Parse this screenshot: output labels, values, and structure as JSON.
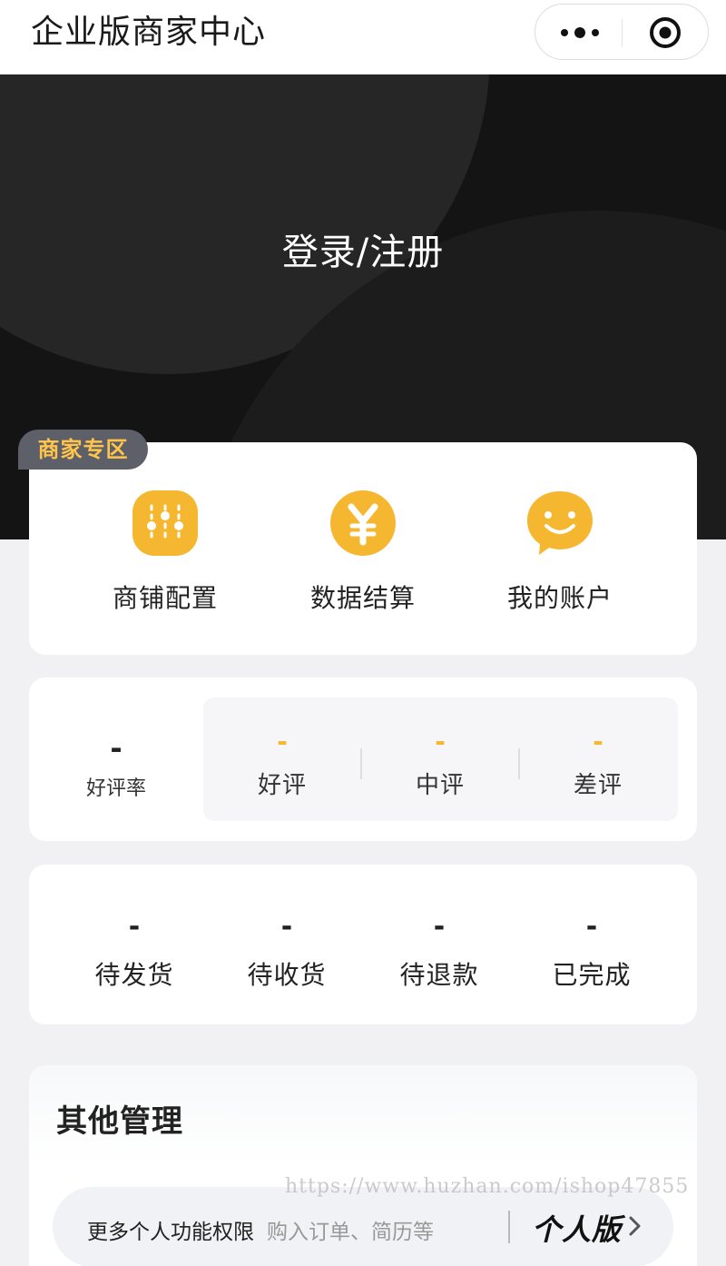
{
  "app": {
    "title": "企业版商家中心"
  },
  "capsule": {
    "more_icon": "more-dots-icon",
    "close_icon": "target-close-icon"
  },
  "hero": {
    "login_label": "登录/注册"
  },
  "merchant": {
    "badge": "商家专区",
    "items": [
      {
        "label": "商铺配置",
        "icon": "sliders-icon"
      },
      {
        "label": "数据结算",
        "icon": "yen-icon"
      },
      {
        "label": "我的账户",
        "icon": "smile-chat-icon"
      }
    ]
  },
  "reviews": {
    "rate": {
      "value": "-",
      "label": "好评率"
    },
    "items": [
      {
        "value": "-",
        "label": "好评"
      },
      {
        "value": "-",
        "label": "中评"
      },
      {
        "value": "-",
        "label": "差评"
      }
    ]
  },
  "orders": [
    {
      "value": "-",
      "label": "待发货"
    },
    {
      "value": "-",
      "label": "待收货"
    },
    {
      "value": "-",
      "label": "待退款"
    },
    {
      "value": "-",
      "label": "已完成"
    }
  ],
  "other": {
    "title": "其他管理",
    "upgrade": {
      "main": "更多个人功能权限",
      "sub": "购入订单、简历等",
      "badge": "个人版"
    }
  },
  "watermark": "https://www.huzhan.com/ishop47855",
  "colors": {
    "accent": "#f5b730",
    "hero_bg": "#141414",
    "badge_bg": "#5d5f69",
    "badge_text": "#ffc44a"
  }
}
